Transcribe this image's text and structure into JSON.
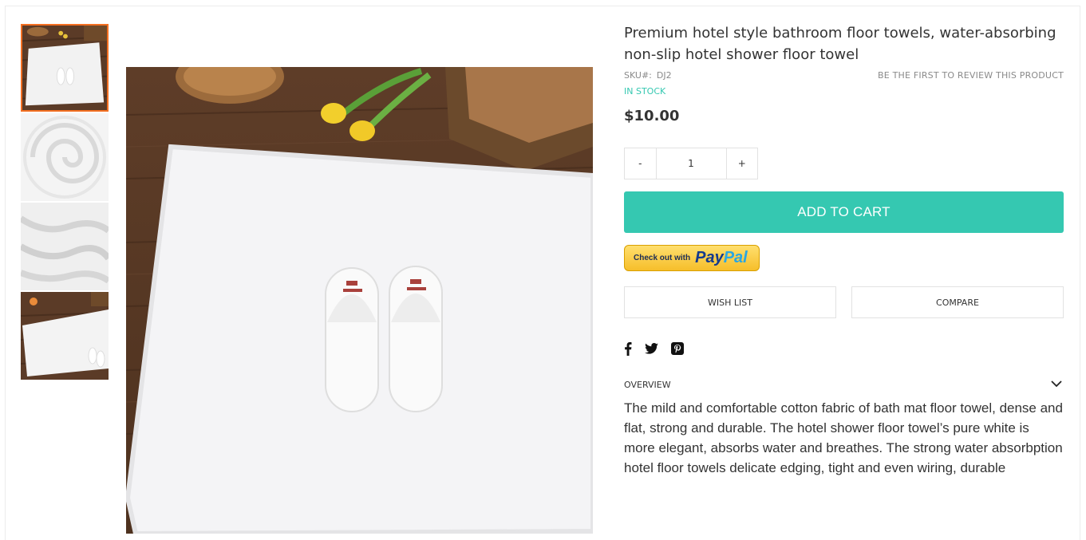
{
  "product": {
    "title": "Premium hotel style bathroom floor towels, water-absorbing non-slip hotel shower floor towel",
    "sku_label": "SKU#:",
    "sku": "DJ2",
    "review_link": "BE THE FIRST TO REVIEW THIS PRODUCT",
    "stock": "IN STOCK",
    "price": "$10.00"
  },
  "quantity": {
    "minus": "-",
    "value": "1",
    "plus": "+"
  },
  "actions": {
    "add_to_cart": "ADD TO CART",
    "paypal_small": "Check out with",
    "paypal_pay": "Pay",
    "paypal_pal": "Pal",
    "wish_list": "WISH LIST",
    "compare": "COMPARE"
  },
  "social": [
    "facebook-icon",
    "twitter-icon",
    "pinterest-icon"
  ],
  "overview": {
    "label": "OVERVIEW",
    "text": "The mild and comfortable cotton fabric of bath mat floor towel, dense and flat, strong and durable. The hotel shower floor towel’s pure white is more elegant, absorbs water and breathes. The strong water absorbption hotel floor towels delicate edging, tight and even wiring, durable"
  },
  "colors": {
    "accent": "#35c8b1",
    "thumb_active": "#f36f21",
    "wood": "#5a3a26"
  }
}
